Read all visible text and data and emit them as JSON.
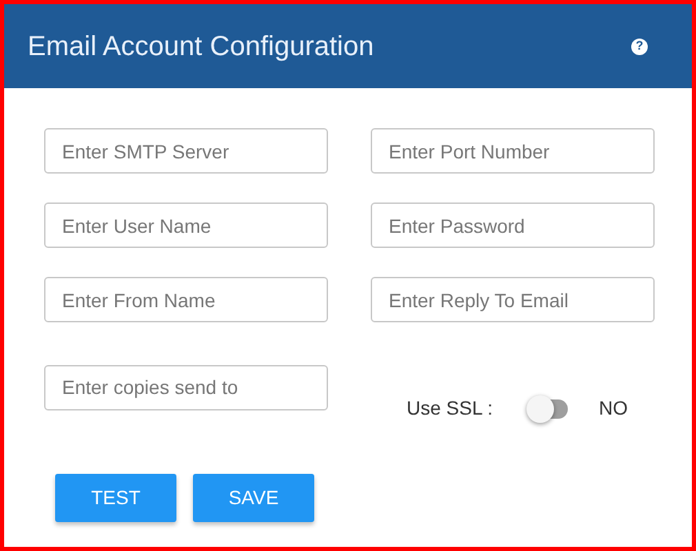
{
  "header": {
    "title": "Email Account Configuration",
    "help": "?"
  },
  "fields": [
    {
      "placeholder": "Enter SMTP Server"
    },
    {
      "placeholder": "Enter Port Number"
    },
    {
      "placeholder": "Enter User Name"
    },
    {
      "placeholder": "Enter Password"
    },
    {
      "placeholder": "Enter From Name"
    },
    {
      "placeholder": "Enter Reply To Email"
    },
    {
      "placeholder": "Enter copies send to"
    }
  ],
  "ssl": {
    "label": "Use SSL :",
    "on": false,
    "state_text": "NO"
  },
  "buttons": [
    "TEST",
    "SAVE"
  ]
}
